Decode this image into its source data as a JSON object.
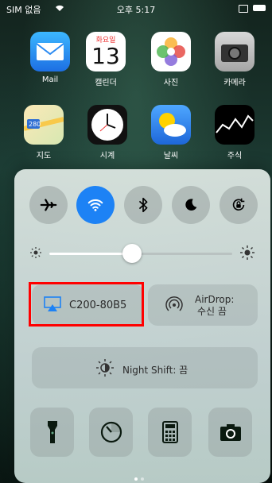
{
  "status_bar": {
    "carrier": "SIM 없음",
    "time": "오후 5:17"
  },
  "home_apps": [
    {
      "label": "Mail"
    },
    {
      "label": "캘린더",
      "day_name": "화요일",
      "day_number": "13"
    },
    {
      "label": "사진"
    },
    {
      "label": "카메라"
    },
    {
      "label": "지도",
      "map_sign": "280"
    },
    {
      "label": "시계"
    },
    {
      "label": "날씨"
    },
    {
      "label": "주식"
    }
  ],
  "control_center": {
    "toggles": [
      {
        "name": "airplane",
        "active": false
      },
      {
        "name": "wifi",
        "active": true
      },
      {
        "name": "bluetooth",
        "active": false
      },
      {
        "name": "do-not-disturb",
        "active": false
      },
      {
        "name": "rotation-lock",
        "active": false
      }
    ],
    "brightness_level": 0.45,
    "airplay": {
      "label": "C200-80B5"
    },
    "airdrop": {
      "line1": "AirDrop:",
      "line2": "수신 끔"
    },
    "night_shift": {
      "label": "Night Shift: 끔"
    },
    "shortcuts": [
      "flashlight",
      "timer",
      "calculator",
      "camera"
    ]
  },
  "colors": {
    "accent": "#1d82f5",
    "highlight": "#ff0000"
  }
}
